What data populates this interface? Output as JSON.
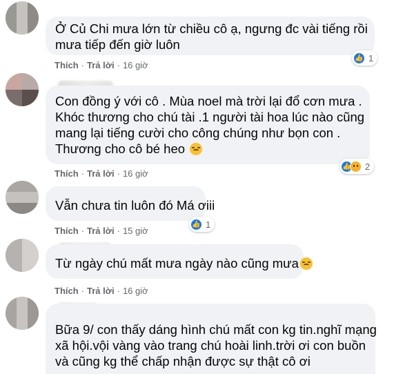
{
  "comments": [
    {
      "lines": [
        "Ở Củ Chi mưa lớn từ chiều cô ạ, ngưng đc vài tiếng rồi",
        "mưa tiếp đến giờ luôn"
      ],
      "actions": {
        "like": "Thích",
        "reply": "Trả lời",
        "time": "16 giờ"
      },
      "reactions": {
        "icons": [
          "like-icon"
        ],
        "count": "1"
      }
    },
    {
      "lines": [
        "Con đồng ý với cô . Mùa noel mà trời lại đổ cơn mưa .",
        "Khóc thương cho chú tài .1 người tài hoa lúc nào cũng",
        "mang lại tiếng cười cho công chúng như bọn con .",
        "Thương cho cô bé heo"
      ],
      "actions": {
        "like": "Thích",
        "reply": "Trả lời",
        "time": "16 giờ"
      },
      "reactions": {
        "icons": [
          "like-icon",
          "sad-icon"
        ],
        "count": "2"
      }
    },
    {
      "lines": [
        "Vẫn chưa tin luôn đó Má ơiii"
      ],
      "actions": {
        "like": "Thích",
        "reply": "Trả lời",
        "time": "15 giờ"
      },
      "reactions": {
        "icons": [
          "like-icon"
        ],
        "count": "1"
      }
    },
    {
      "lines": [
        "Từ ngày chú mất mưa ngày nào cũng mưa"
      ],
      "actions": {
        "like": "Thích",
        "reply": "Trả lời",
        "time": "16 giờ"
      },
      "reactions": {
        "icons": [],
        "count": ""
      }
    },
    {
      "lines": [
        "Bữa 9/ con thấy dáng hình chú mất con kg tin.nghĩ mạng",
        "xã hội.vội vàng vào trang chú hoài linh.trời ơi con buồn",
        "và cũng kg thể chấp nhận được sự thật cô ơi"
      ],
      "actions": {
        "like": "",
        "reply": "",
        "time": ""
      },
      "reactions": {
        "icons": [],
        "count": ""
      }
    }
  ],
  "colors": {
    "bubble": "#f0f2f5",
    "text": "#050505",
    "meta": "#65676b",
    "like": "#1877f2",
    "sad": "#f7b125"
  }
}
